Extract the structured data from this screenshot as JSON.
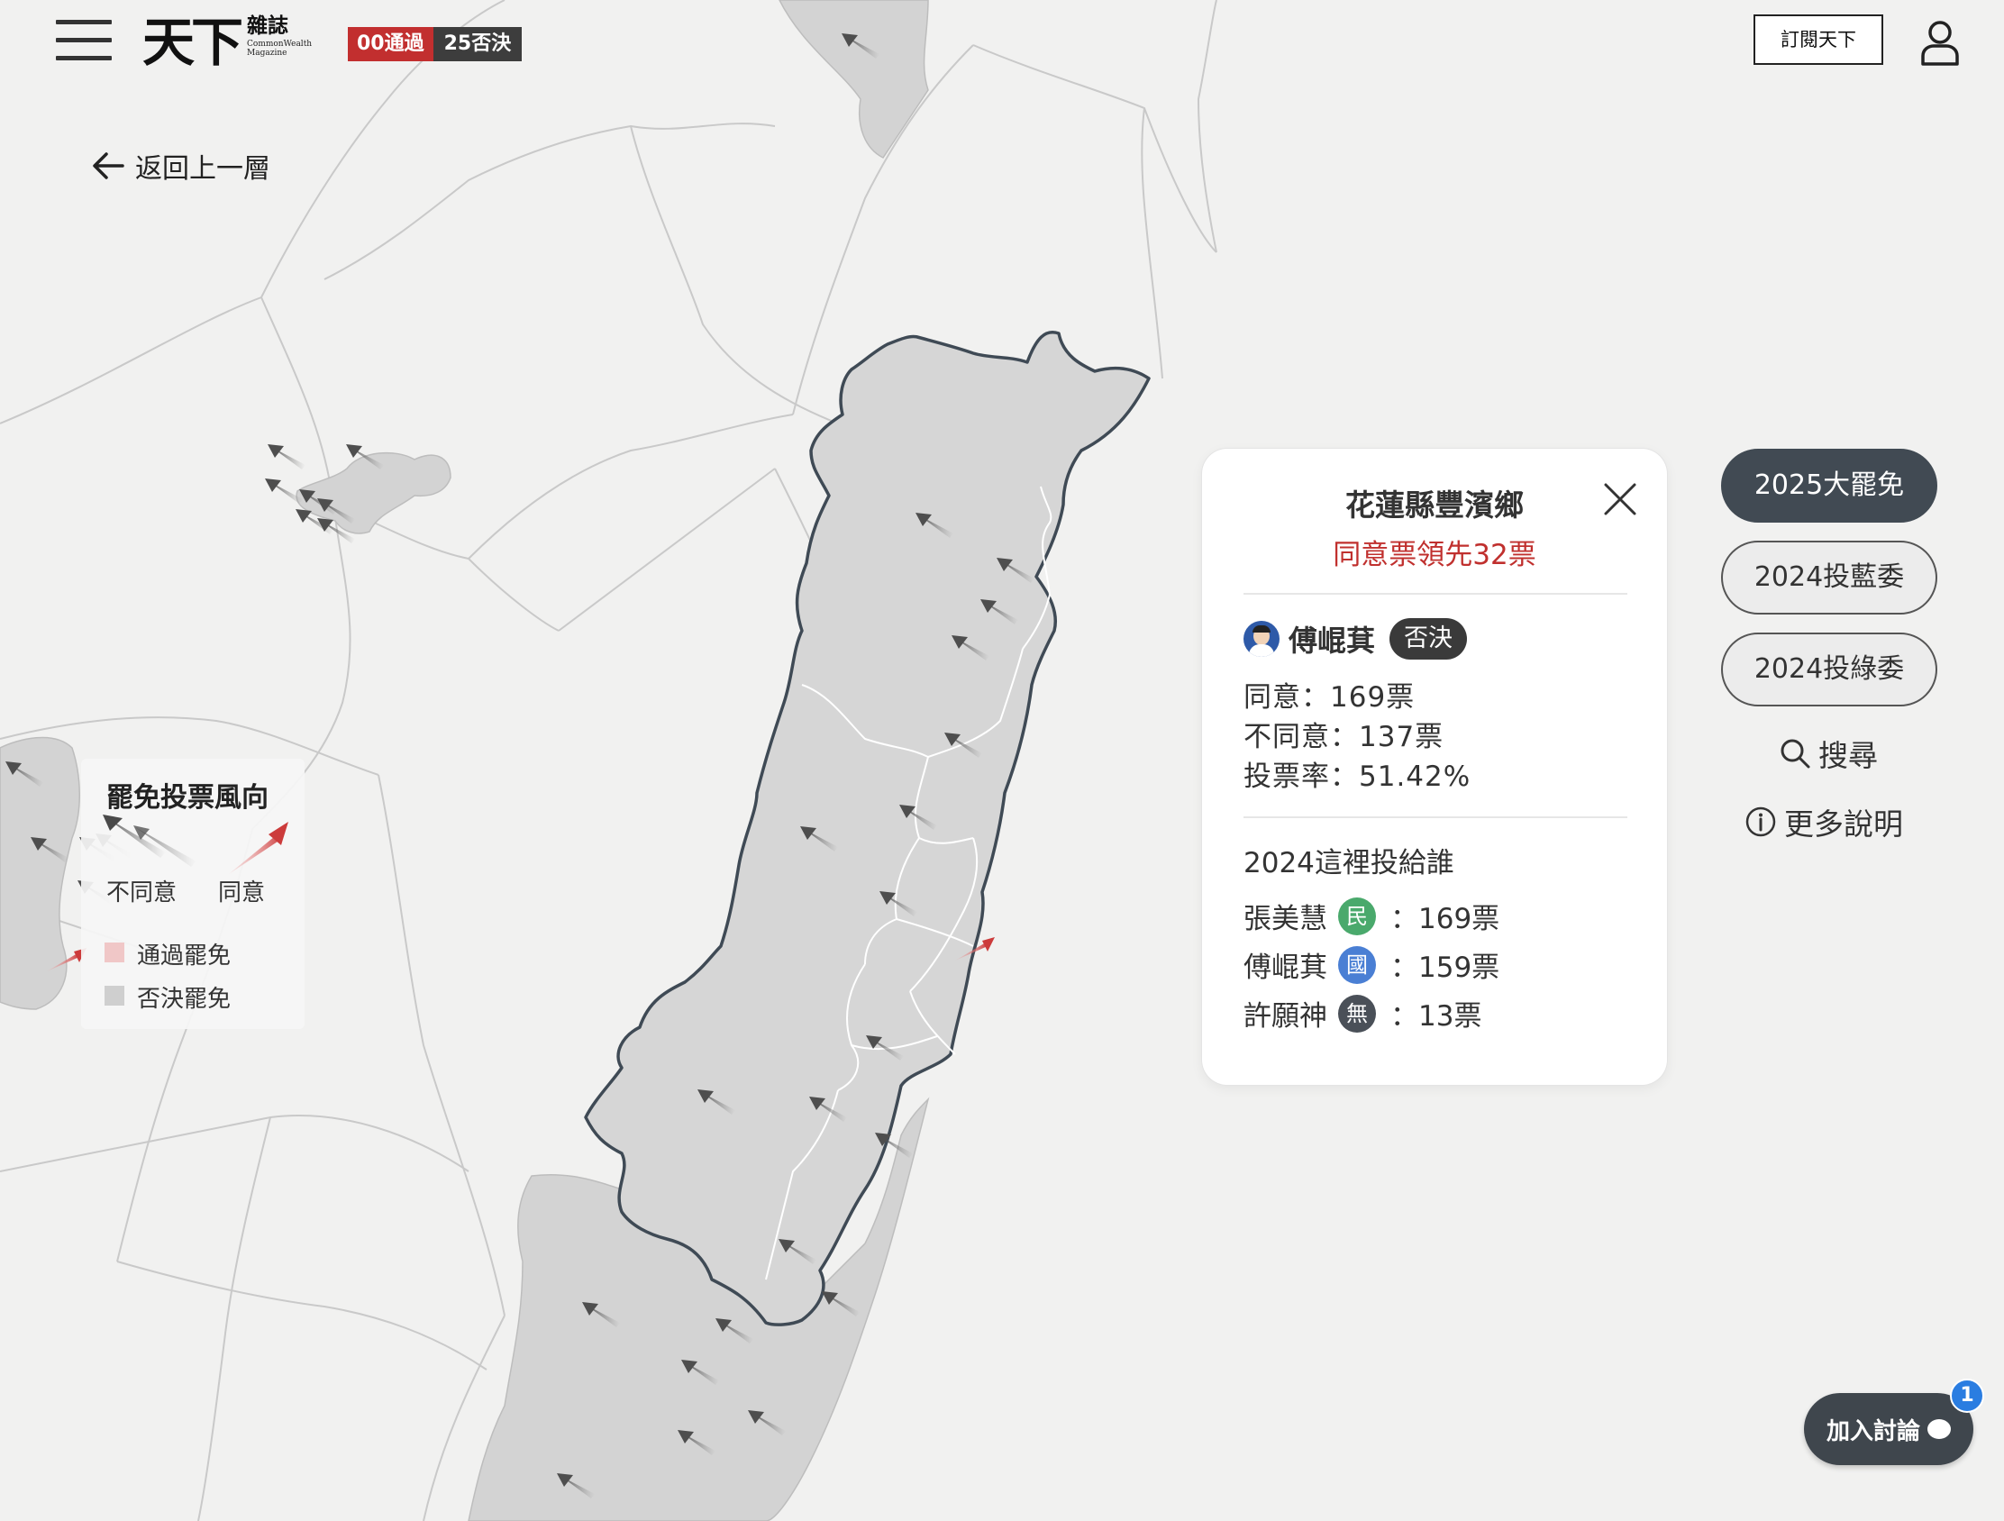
{
  "header": {
    "logo_main": "天下",
    "logo_zh": "雜誌",
    "logo_en_1": "CommonWealth",
    "logo_en_2": "Magazine",
    "pass_label": "00通過",
    "reject_label": "25否決",
    "subscribe_label": "訂閱天下"
  },
  "back_label": "返回上一層",
  "legend": {
    "title": "罷免投票風向",
    "disagree_label": "不同意",
    "agree_label": "同意",
    "pass_label": "通過罷免",
    "reject_label": "否決罷免"
  },
  "card": {
    "township": "花蓮縣豐濱鄉",
    "lead_text": "同意票領先32票",
    "candidate": "傅崐萁",
    "result_badge": "否決",
    "agree": "同意：169票",
    "disagree": "不同意：137票",
    "turnout": "投票率：51.42%",
    "section_title": "2024這裡投給誰",
    "votes": [
      {
        "name": "張美慧",
        "party": "民",
        "party_color": "#4aa96c",
        "count": "：169票"
      },
      {
        "name": "傅崐萁",
        "party": "國",
        "party_color": "#4a7fd4",
        "count": "：159票"
      },
      {
        "name": "許願神",
        "party": "無",
        "party_color": "#4a5058",
        "count": "：13票"
      }
    ]
  },
  "modes": [
    "2025大罷免",
    "2024投藍委",
    "2024投綠委"
  ],
  "search_label": "搜尋",
  "more_label": "更多說明",
  "discuss_label": "加入討論",
  "notification_count": "1",
  "colors": {
    "agree_arrow": "#cc3b3b",
    "disagree_arrow": "#555555",
    "rejected_region": "#d3d3d3",
    "passed_region": "#f0c7c7",
    "background": "#f1f1f0"
  }
}
